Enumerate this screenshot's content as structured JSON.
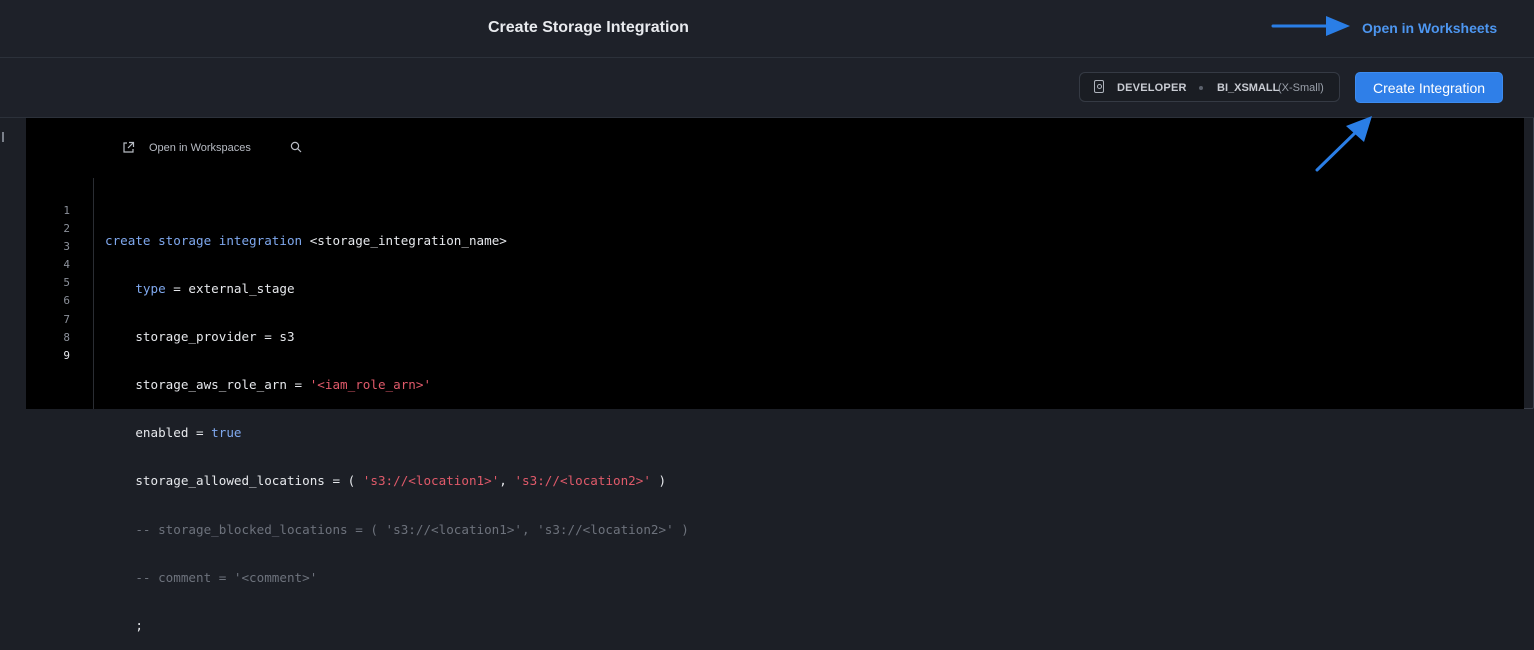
{
  "header": {
    "title": "Create Storage Integration",
    "open_in_worksheets": "Open in Worksheets"
  },
  "toolbar": {
    "role": "DEVELOPER",
    "warehouse": "BI_XSMALL",
    "warehouse_size": "(X-Small)",
    "create_button": "Create Integration"
  },
  "editor": {
    "open_in_workspaces": "Open in Workspaces",
    "line_numbers": [
      "1",
      "2",
      "3",
      "4",
      "5",
      "6",
      "7",
      "8",
      "9"
    ],
    "code": {
      "l1_kw": "create storage integration",
      "l1_rest": " <storage_integration_name>",
      "l2_indent": "    ",
      "l2_kw": "type",
      "l2_rest": " = external_stage",
      "l3": "    storage_provider = s3",
      "l4_a": "    storage_aws_role_arn = ",
      "l4_str": "'<iam_role_arn>'",
      "l5_a": "    enabled = ",
      "l5_kw": "true",
      "l6_a": "    storage_allowed_locations = ( ",
      "l6_s1": "'s3://<location1>'",
      "l6_b": ", ",
      "l6_s2": "'s3://<location2>'",
      "l6_c": " )",
      "l7": "    -- storage_blocked_locations = ( 's3://<location1>', 's3://<location2>' )",
      "l8": "    -- comment = '<comment>'",
      "l9": "    ;"
    }
  },
  "colors": {
    "accent": "#2f7fe8",
    "annotation_arrow": "#2a7ee6",
    "keyword": "#7fa8ee",
    "string": "#e05a6a",
    "comment": "#6d727c"
  },
  "icons": [
    "external-link-icon",
    "search-icon",
    "role-icon",
    "annotation-arrow"
  ]
}
